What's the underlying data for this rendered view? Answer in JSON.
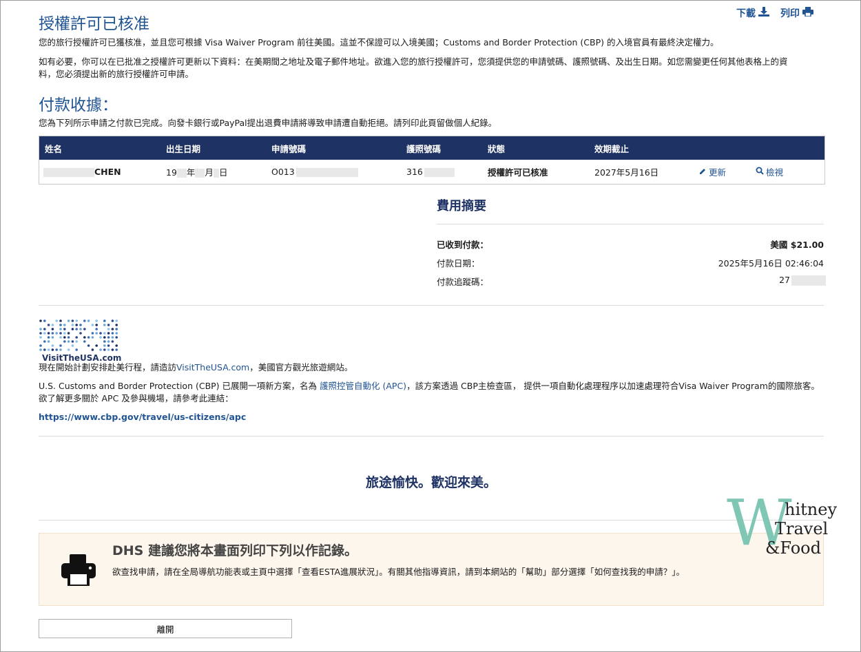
{
  "header": {
    "title": "授權許可已核准",
    "download_label": "下載",
    "print_label": "列印"
  },
  "intro": {
    "para1": "您的旅行授權許可已獲核准，並且您可根據 Visa Waiver Program 前往美國。這並不保證可以入境美國；Customs and Border Protection (CBP) 的入境官員有最終決定權力。",
    "para2_line1": "如有必要，你可以在已批准之授權許可更新以下資料：在美期間之地址及電子郵件地址。欲進入您的旅行授權許可，您須提供您的申請號碼、護照號碼、及出生日期。如您需變更任何其他表格上的資",
    "para2_line2": "料，您必須提出新的旅行授權許可申請。"
  },
  "payment": {
    "title": "付款收據：",
    "desc": "您為下列所示申請之付款已完成。向發卡銀行或PayPal提出退費申請將導致申請遭自動拒絕。請列印此頁留做個人紀錄。"
  },
  "table": {
    "headers": [
      "姓名",
      "出生日期",
      "申請號碼",
      "護照號碼",
      "狀態",
      "效期截止"
    ],
    "row": {
      "name_visible": "CHEN",
      "dob_prefix": "19",
      "dob_year": "年",
      "dob_month": "月",
      "dob_day": "日",
      "app_prefix": "O013",
      "passport_prefix": "316",
      "status": "授權許可已核准",
      "expiry": "2027年5月16日",
      "update_label": "更新",
      "view_label": "檢視"
    }
  },
  "fees": {
    "title": "費用摘要",
    "received_label": "已收到付款：",
    "received_value": "美國 $21.00",
    "date_label": "付款日期：",
    "date_value": "2025年5月16日 02:46:04",
    "tracking_label": "付款追蹤碼：",
    "tracking_prefix": "27"
  },
  "visit": {
    "logo_text": "VisitTheUSA.com",
    "line_prefix": "現在開始計劃安排赴美行程，請造訪",
    "line_link": "VisitTheUSA.com",
    "line_suffix": "，美國官方觀光旅遊網站。"
  },
  "apc": {
    "line1_prefix": "U.S. Customs and Border Protection (CBP) 已展開一項新方案，名為 ",
    "line1_link": "護照控管自動化 (APC)",
    "line1_suffix": "，該方案透過 CBP主檢查區， 提供一項自動化處理程序以加速處理符合Visa Waiver Program的國際旅客。",
    "line2": "欲了解更多關於 APC 及參與機場，請參考此連結：",
    "url": "https://www.cbp.gov/travel/us-citizens/apc"
  },
  "welcome": "旅途愉快。歡迎來美。",
  "notice": {
    "title": "DHS 建議您將本畫面列印下列以作記錄。",
    "body": "欲查找申請，請在全局導航功能表或主頁中選擇「查看ESTA進展狀況」。有關其他指導資訊，請到本網站的「幫助」部分選擇「如何查找我的申請？」。"
  },
  "leave_label": "離開",
  "watermark": {
    "big_letter": "W",
    "line1": "hitney",
    "line2": "Travel",
    "line3": "&Food"
  },
  "colors": {
    "accent": "#205493",
    "table_header": "#1f3264",
    "notice_bg": "#fdf6ec",
    "watermark": "#7fc7b4"
  }
}
